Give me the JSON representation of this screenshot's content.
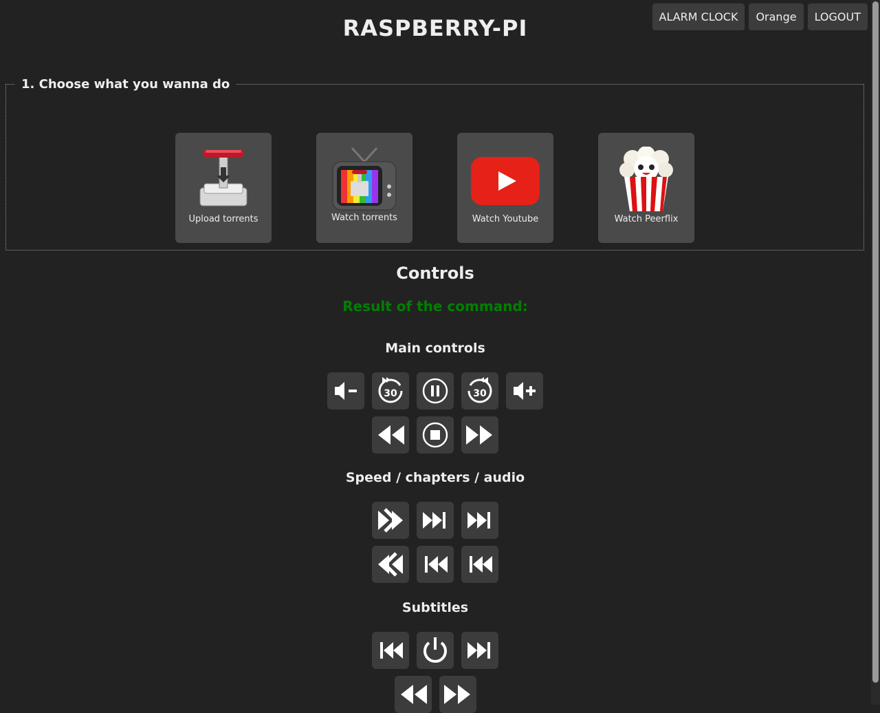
{
  "header": {
    "title": "RASPBERRY-PI",
    "buttons": {
      "alarm": "ALARM CLOCK",
      "user": "Orange",
      "logout": "LOGOUT"
    }
  },
  "choose": {
    "legend": "1. Choose what you wanna do",
    "tiles": [
      {
        "label": "Upload torrents",
        "icon": "transmission-upload-icon"
      },
      {
        "label": "Watch torrents",
        "icon": "tv-torrent-icon"
      },
      {
        "label": "Watch Youtube",
        "icon": "youtube-icon"
      },
      {
        "label": "Watch Peerflix",
        "icon": "popcorn-icon"
      }
    ]
  },
  "controls": {
    "title": "Controls",
    "result_label": "Result of the command:",
    "main_title": "Main controls",
    "speed_title": "Speed / chapters / audio",
    "subtitles_title": "Subtitles",
    "seek_seconds": "30"
  },
  "colors": {
    "background": "#222222",
    "button": "#3c3c3c",
    "tile": "#4a4a4a",
    "result": "#008000",
    "youtube": "#e62117"
  }
}
